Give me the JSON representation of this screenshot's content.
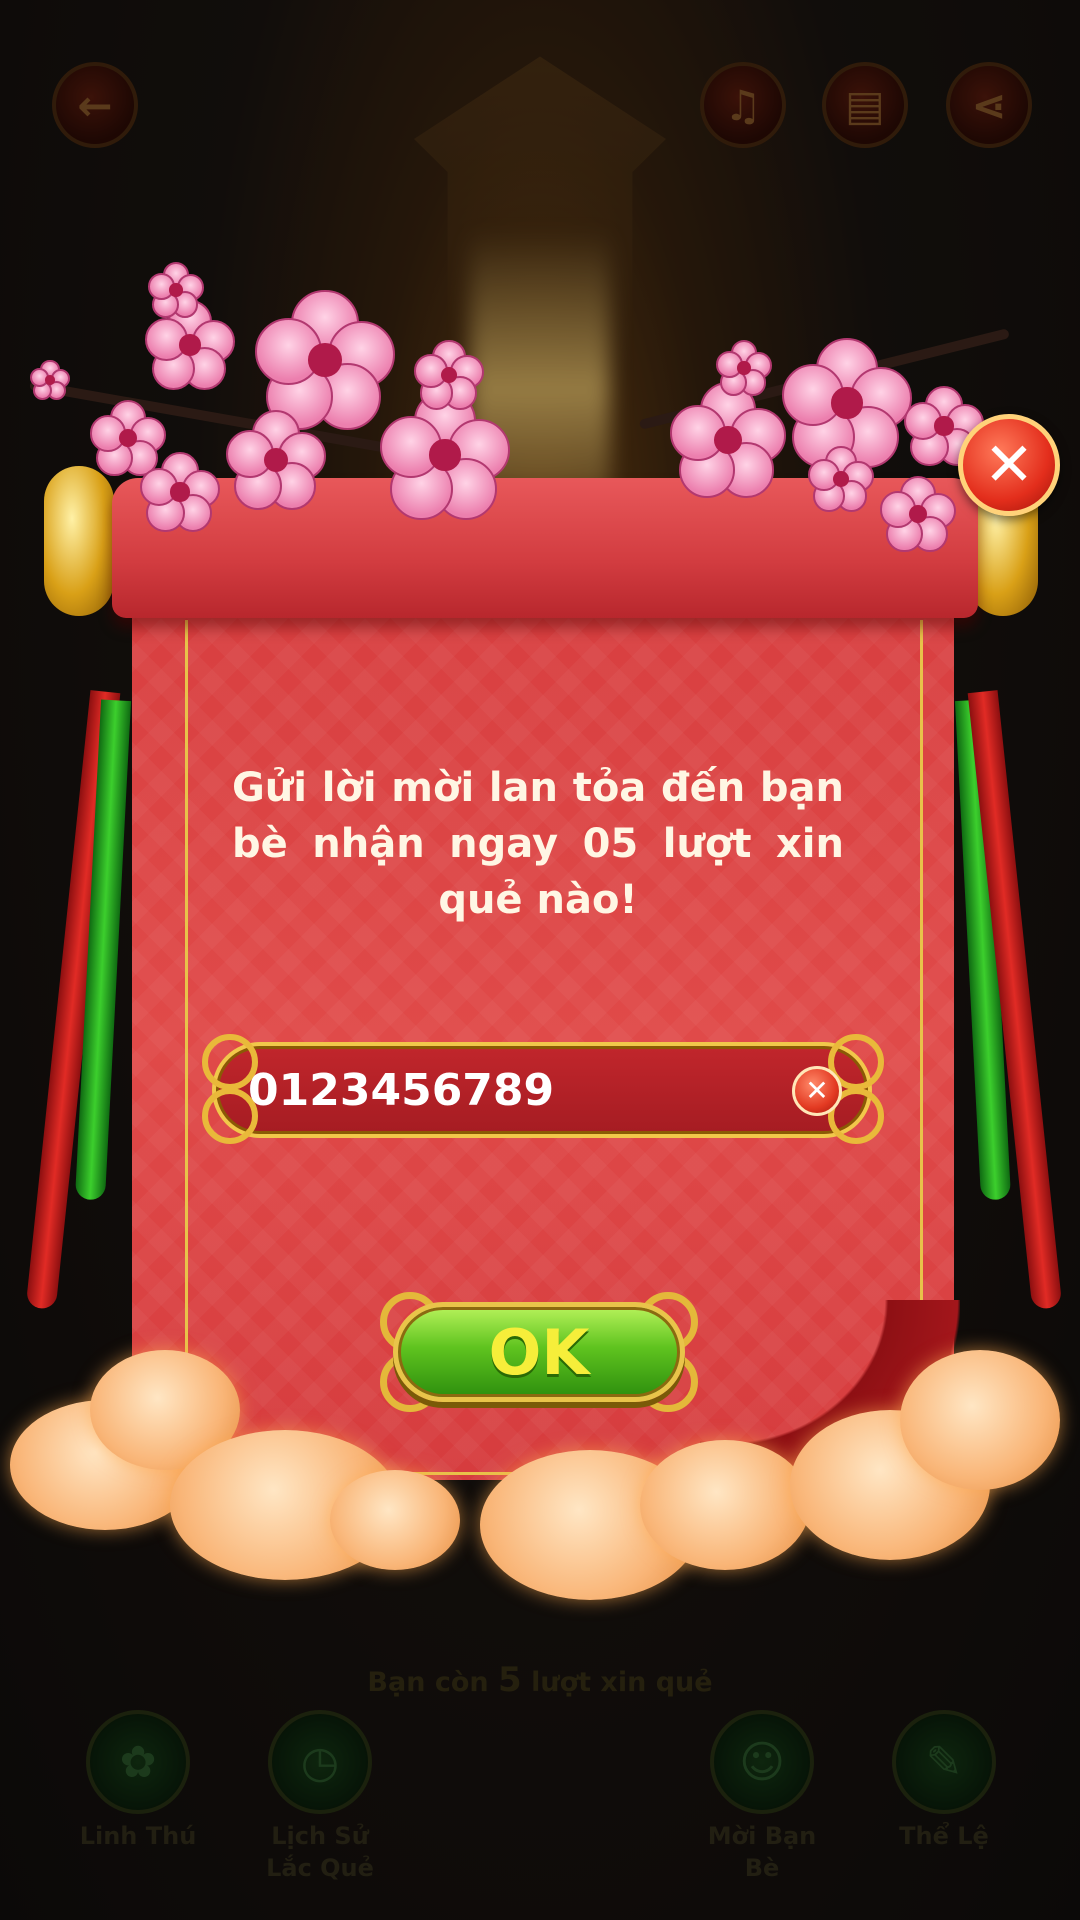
{
  "background": {
    "top_bar": {
      "back_icon": "arrow-left-icon",
      "music_icon": "music-muted-icon",
      "leaderboard_icon": "bar-chart-icon",
      "share_icon": "share-icon"
    },
    "remaining_prefix": "Bạn còn ",
    "remaining_count": "5",
    "remaining_suffix": " lượt xin quẻ",
    "nav": [
      {
        "label": "Linh Thú",
        "icon": "paw-icon"
      },
      {
        "label": "Lịch Sử Lắc Quẻ",
        "icon": "history-icon"
      },
      {
        "label": "Mời Bạn Bè",
        "icon": "add-friend-icon"
      },
      {
        "label": "Thể Lệ",
        "icon": "rules-scroll-icon"
      }
    ]
  },
  "dialog": {
    "message": "Gửi lời mời lan tỏa đến bạn bè nhận ngay 05 lượt xin quẻ nào!",
    "phone_input": {
      "value": "0123456789"
    },
    "clear_icon": "close-icon",
    "ok_label": "OK",
    "close_icon": "close-icon"
  },
  "colors": {
    "scroll_red": "#d83f40",
    "gold_trim": "#e8c24a",
    "ok_green": "#5fc31f",
    "ok_text": "#f6ee3a"
  }
}
